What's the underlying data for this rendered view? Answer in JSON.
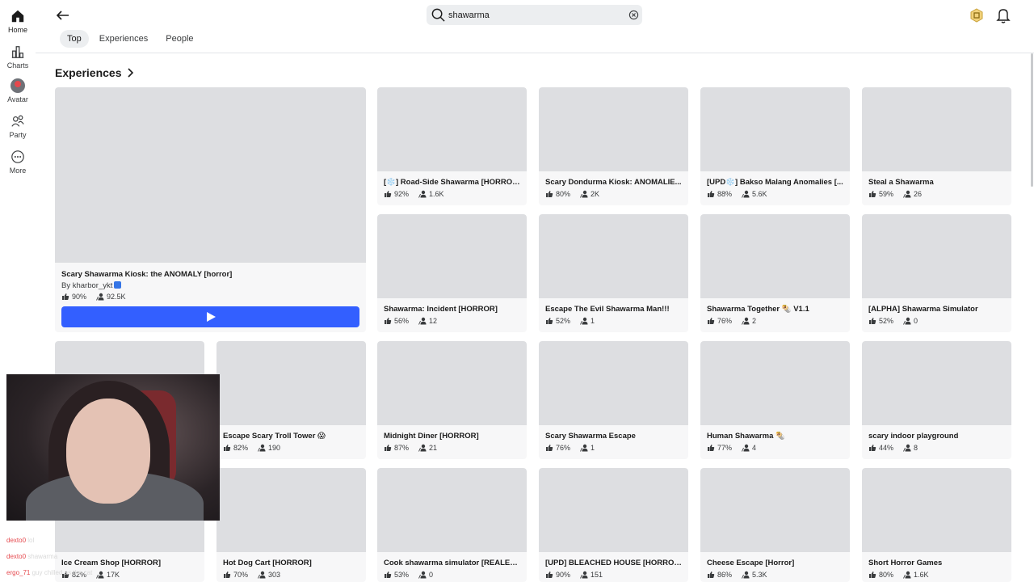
{
  "nav": {
    "items": [
      {
        "label": "Home",
        "icon": "home-icon"
      },
      {
        "label": "Charts",
        "icon": "charts-icon"
      },
      {
        "label": "Avatar",
        "icon": "avatar-icon"
      },
      {
        "label": "Party",
        "icon": "party-icon"
      },
      {
        "label": "More",
        "icon": "more-icon"
      }
    ]
  },
  "search": {
    "value": "shawarma"
  },
  "tabs": [
    "Top",
    "Experiences",
    "People"
  ],
  "section": {
    "title": "Experiences"
  },
  "featured": {
    "title": "Scary Shawarma Kiosk: the ANOMALY [horror]",
    "by": "By kharbor_ykt",
    "rating": "90%",
    "players": "92.5K"
  },
  "cards": [
    {
      "title": "[❄️] Road-Side Shawarma [HORROR]",
      "rating": "92%",
      "players": "1.6K"
    },
    {
      "title": "Scary Dondurma Kiosk: ANOMALIE...",
      "rating": "80%",
      "players": "2K"
    },
    {
      "title": "[UPD❄️] Bakso Malang Anomalies [...",
      "rating": "88%",
      "players": "5.6K"
    },
    {
      "title": "Steal a Shawarma",
      "rating": "59%",
      "players": "26"
    },
    {
      "title": "Shawarma: Incident [HORROR]",
      "rating": "56%",
      "players": "12"
    },
    {
      "title": "Escape The Evil Shawarma Man!!!",
      "rating": "52%",
      "players": "1"
    },
    {
      "title": "Shawarma Together 🌯 V1.1",
      "rating": "76%",
      "players": "2"
    },
    {
      "title": "[ALPHA] Shawarma Simulator",
      "rating": "52%",
      "players": "0"
    },
    {
      "title": "Escape Scary Troll Tower 😱",
      "rating": "82%",
      "players": "190"
    },
    {
      "title": "Midnight Diner [HORROR]",
      "rating": "87%",
      "players": "21"
    },
    {
      "title": "Scary Shawarma Escape",
      "rating": "76%",
      "players": "1"
    },
    {
      "title": "Human Shawarma 🌯",
      "rating": "77%",
      "players": "4"
    },
    {
      "title": "scary indoor playground",
      "rating": "44%",
      "players": "8"
    },
    {
      "title": "Ice Cream Shop [HORROR]",
      "rating": "82%",
      "players": "17K"
    },
    {
      "title": "Hot Dog Cart [HORROR]",
      "rating": "70%",
      "players": "303"
    },
    {
      "title": "Cook shawarma simulator [REALESE]",
      "rating": "53%",
      "players": "0"
    },
    {
      "title": "[UPD] BLEACHED HOUSE [HORROR]",
      "rating": "90%",
      "players": "151"
    },
    {
      "title": "Cheese Escape [Horror]",
      "rating": "86%",
      "players": "5.3K"
    },
    {
      "title": "Short Horror Games",
      "rating": "80%",
      "players": "1.6K"
    }
  ],
  "chat": [
    {
      "user": "dexto0",
      "text": "lol"
    },
    {
      "user": "dexto0",
      "text": "shawarma"
    },
    {
      "user": "ergo_71",
      "text": "guy chilled as the cat"
    }
  ]
}
